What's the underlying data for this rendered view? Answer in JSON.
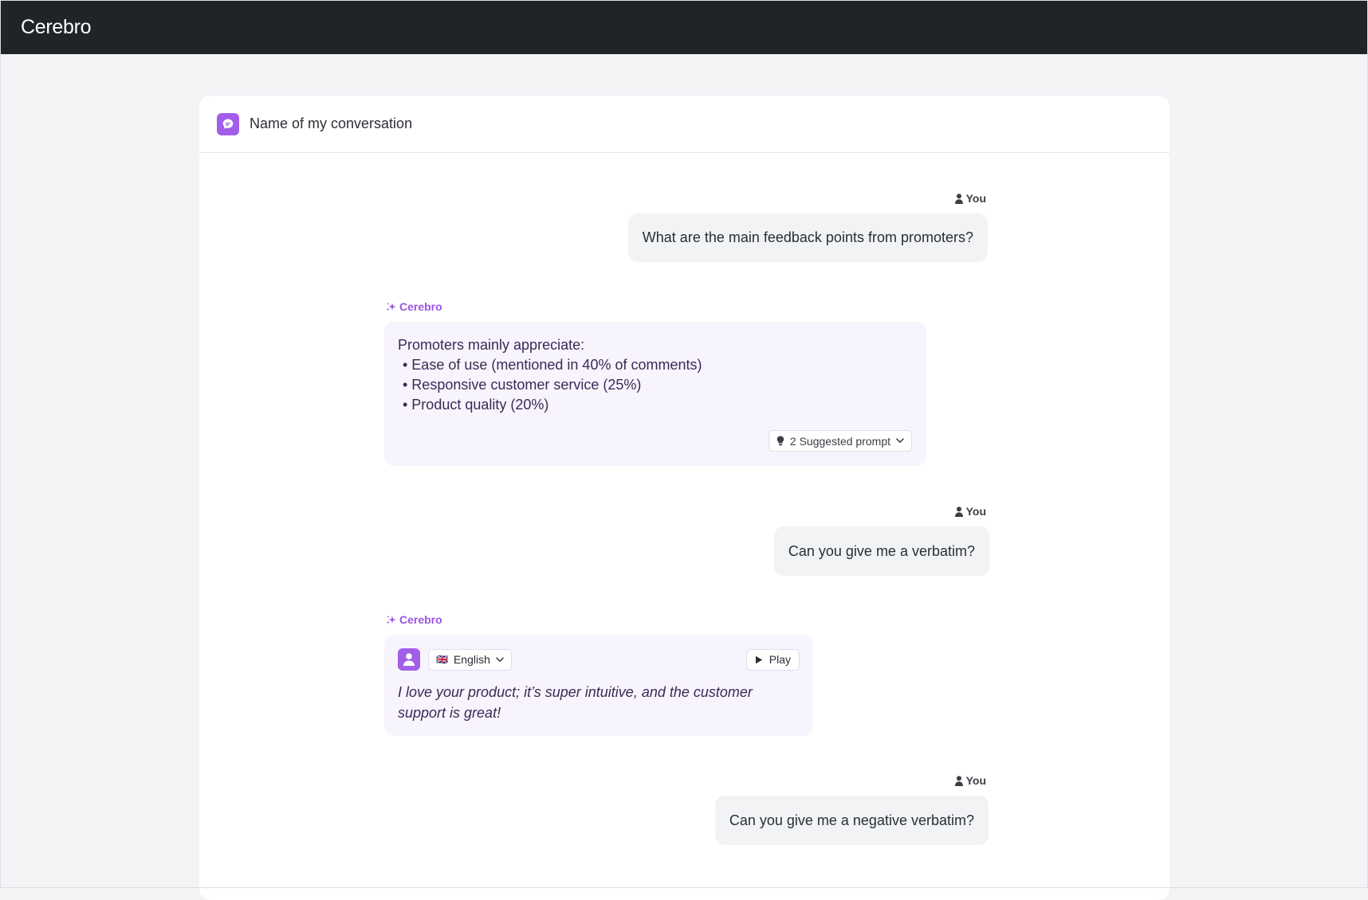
{
  "app": {
    "brand": "Cerebro"
  },
  "conversation": {
    "title": "Name of my conversation"
  },
  "messages": {
    "m1": {
      "author": "You",
      "text": "What are the main feedback points from promoters?"
    },
    "m2": {
      "author": "Cerebro",
      "intro": "Promoters mainly appreciate:",
      "bullets": [
        "• Ease of use (mentioned in 40% of comments)",
        "• Responsive customer service (25%)",
        "• Product quality (20%)"
      ],
      "suggested_label": "2 Suggested prompt"
    },
    "m3": {
      "author": "You",
      "text": "Can you give me a verbatim?"
    },
    "m4": {
      "author": "Cerebro",
      "language": "English",
      "flag": "🇬🇧",
      "play_label": "Play",
      "quote": "I love your product; it’s super intuitive, and the customer support is great!"
    },
    "m5": {
      "author": "You",
      "text": "Can you give me a negative verbatim?"
    }
  },
  "colors": {
    "topbar": "#202428",
    "accent": "#a35ee9",
    "bot_bubble": "#f8f4fd",
    "user_bubble": "#f2f3f5"
  },
  "icons": {
    "conversation": "chat-bubble-icon",
    "user": "user-icon",
    "bot": "sparkle-icon",
    "suggested": "lightbulb-icon",
    "dropdown": "chevron-down-icon",
    "play": "play-icon",
    "verbatim_avatar": "person-icon"
  }
}
